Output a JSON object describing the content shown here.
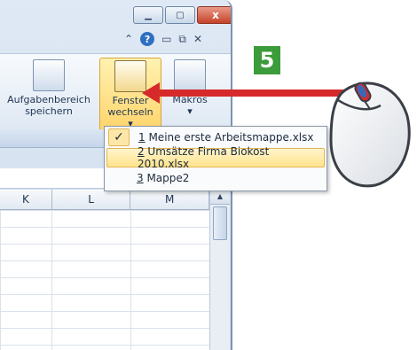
{
  "window": {
    "minimize_icon": "minimize-icon",
    "maximize_icon": "maximize-icon",
    "close_icon": "close-icon",
    "close_glyph": "x"
  },
  "ribbon": {
    "top_icons": [
      "chevron-up-icon",
      "help-icon",
      "minimize-icon",
      "restore-icon",
      "close-icon"
    ],
    "help_glyph": "?",
    "buttons": [
      {
        "label_line1": "Aufgabenbereich",
        "label_line2": "speichern"
      },
      {
        "label_line1": "Fenster",
        "label_line2": "wechseln ▾"
      },
      {
        "label_line1": "Makros",
        "label_line2": "▾"
      }
    ]
  },
  "grid": {
    "columns": [
      "K",
      "L",
      "M"
    ]
  },
  "menu": {
    "items": [
      {
        "key": "1",
        "label": " Meine erste Arbeitsmappe.xlsx",
        "checked": true
      },
      {
        "key": "2",
        "label": " Umsätze Firma Biokost 2010.xlsx",
        "checked": false,
        "highlighted": true
      },
      {
        "key": "3",
        "label": " Mappe2",
        "checked": false
      }
    ],
    "check_glyph": "✓"
  },
  "annotation": {
    "step_number": "5",
    "arrow_color": "#d62a2a",
    "badge_color": "#3c9b3a"
  }
}
